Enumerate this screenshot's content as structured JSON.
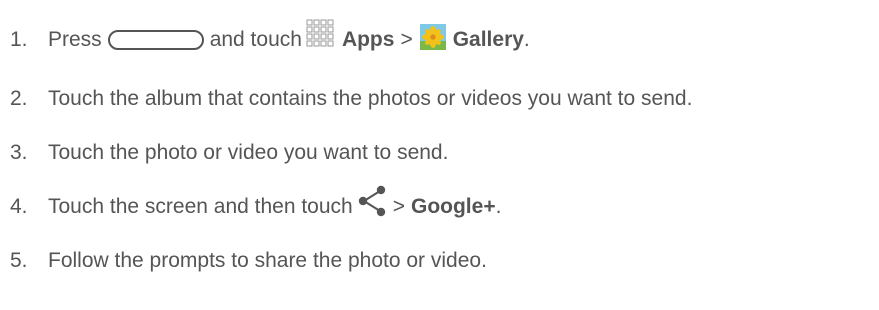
{
  "steps": [
    {
      "num": "1.",
      "parts": {
        "press": "Press",
        "and_touch": "and touch",
        "apps": "Apps",
        "sep": ">",
        "gallery": "Gallery",
        "end": "."
      }
    },
    {
      "num": "2.",
      "text": "Touch the album that contains the photos or videos you want to send."
    },
    {
      "num": "3.",
      "text": "Touch the photo or video you want to send."
    },
    {
      "num": "4.",
      "parts": {
        "lead": "Touch the screen and then touch",
        "sep": ">",
        "google": "Google+",
        "end": "."
      }
    },
    {
      "num": "5.",
      "text": "Follow the prompts to share the photo or video."
    }
  ],
  "icons": {
    "home_key": "home-key-icon",
    "apps": "apps-grid-icon",
    "gallery": "gallery-icon",
    "share": "share-icon"
  },
  "colors": {
    "text": "#555555",
    "apps_grid": "#9a9a9a",
    "gallery_bg": "#7ec8e8",
    "gallery_flower": "#f2c21b",
    "share": "#555555"
  }
}
